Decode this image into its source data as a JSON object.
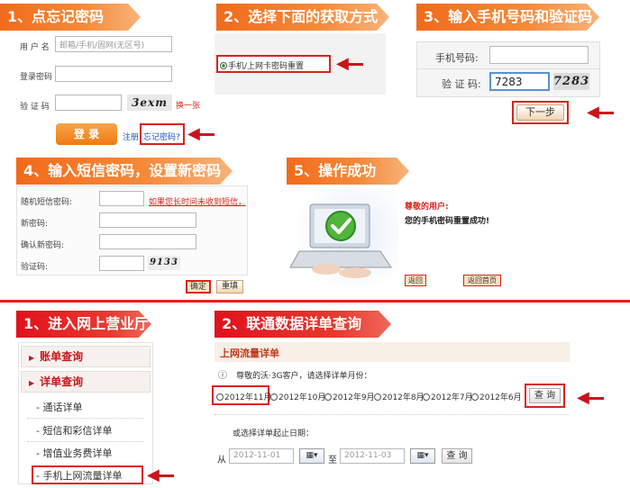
{
  "step1": {
    "banner": "1、点忘记密码",
    "username_label": "用 户 名",
    "username_placeholder": "邮箱/手机/固网(无区号)",
    "password_label": "登录密码",
    "captcha_label": "验 证 码",
    "captcha_text": "3exm",
    "refresh": "换一张",
    "login": "登 录",
    "register": "注册",
    "forgot": "忘记密码?"
  },
  "step2": {
    "banner": "2、选择下面的获取方式",
    "option": "手机/上网卡密码重置"
  },
  "step3": {
    "banner": "3、输入手机号码和验证码",
    "phone_label": "手机号码:",
    "captcha_label": "验 证 码:",
    "captcha_value": "7283",
    "captcha_text": "7283",
    "next": "下一步"
  },
  "step4": {
    "banner": "4、输入短信密码，设置新密码",
    "sms_label": "随机短信密码:",
    "sms_link": "如果您长时间未收到短信，",
    "new_label": "新密码:",
    "confirm_label": "确认新密码:",
    "captcha_label": "验证码:",
    "captcha_text": "9133",
    "ok": "确定",
    "reset": "重填"
  },
  "step5": {
    "banner": "5、操作成功",
    "greeting": "尊敬的用户:",
    "message": "您的手机密码重置成功!",
    "back": "返回",
    "home": "返回首页"
  },
  "sectionB": {
    "banner1": "1、进入网上营业厅",
    "menu": {
      "account": "账单查询",
      "detail": "详单查询",
      "items": [
        "通话详单",
        "短信和彩信详单",
        "增值业务费详单",
        "手机上网流量详单"
      ]
    },
    "banner2": "2、联通数据详单查询",
    "title": "上网流量详单",
    "tip": "尊敬的沃·3G客户，请选择详单月份：",
    "months": [
      "2012年11月",
      "2012年10月",
      "2012年9月",
      "2012年8月",
      "2012年7月",
      "2012年6月"
    ],
    "query": "查 询",
    "range_tip": "或选择详单起止日期：",
    "from": "从",
    "to": "至",
    "date_from": "2012-11-01",
    "date_to": "2012-11-03",
    "query2": "查 询"
  }
}
